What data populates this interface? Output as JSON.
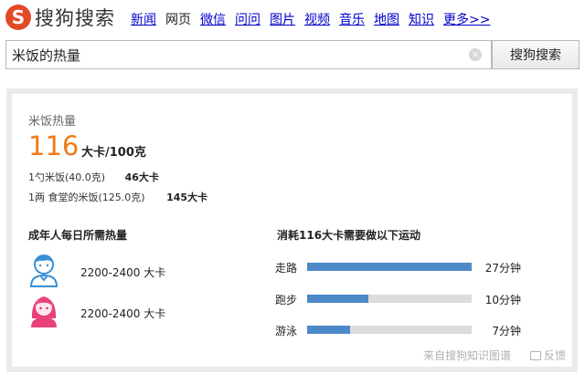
{
  "logo": {
    "mark": "S",
    "text": "搜狗搜索"
  },
  "nav": [
    "新闻",
    "网页",
    "微信",
    "问问",
    "图片",
    "视频",
    "音乐",
    "地图",
    "知识",
    "更多>>"
  ],
  "nav_active_index": 1,
  "search": {
    "query": "米饭的热量",
    "clear": "×",
    "button": "搜狗搜索"
  },
  "card": {
    "title": "米饭热量",
    "calories_value": "116",
    "calories_unit": "大卡/100克",
    "servings": [
      {
        "label": "1勺米饭(40.0克)",
        "value": "46大卡"
      },
      {
        "label": "1两 食堂的米饭(125.0克)",
        "value": "145大卡"
      }
    ],
    "daily_title": "成年人每日所需热量",
    "daily": [
      {
        "gender": "male",
        "icon": "male-avatar-icon",
        "range": "2200-2400 大卡"
      },
      {
        "gender": "female",
        "icon": "female-avatar-icon",
        "range": "2200-2400 大卡"
      }
    ],
    "exercise_title": "消耗116大卡需要做以下运动",
    "exercise": [
      {
        "name": "走路",
        "minutes": "27分钟",
        "fraction": 1.0
      },
      {
        "name": "跑步",
        "minutes": "10分钟",
        "fraction": 0.37
      },
      {
        "name": "游泳",
        "minutes": "7分钟",
        "fraction": 0.26
      }
    ],
    "source": "来自搜狗知识图谱",
    "feedback": "反馈"
  },
  "colors": {
    "accent_orange": "#f07a18",
    "bar_fill": "#4d88c9",
    "bar_track": "#dcdcdc",
    "logo_red": "#e24a27",
    "link_blue": "#0000cc"
  }
}
